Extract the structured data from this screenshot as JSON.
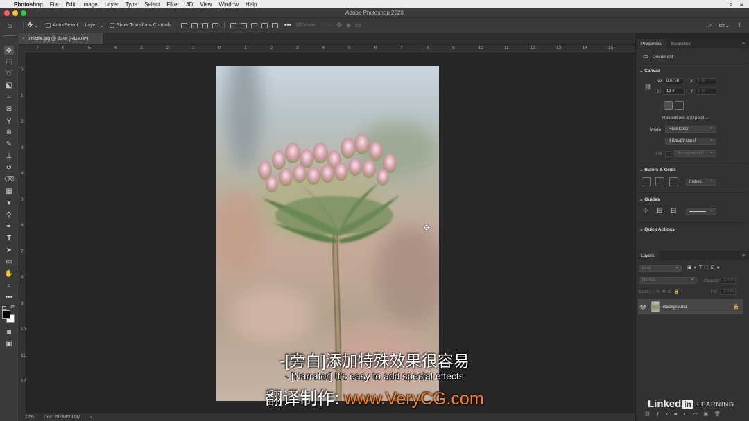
{
  "menubar": {
    "app": "Photoshop",
    "items": [
      "File",
      "Edit",
      "Image",
      "Layer",
      "Type",
      "Select",
      "Filter",
      "3D",
      "View",
      "Window",
      "Help"
    ]
  },
  "window": {
    "title": "Adobe Photoshop 2020"
  },
  "options": {
    "auto_select_label": "Auto-Select:",
    "auto_select_target": "Layer",
    "show_transform_label": "Show Transform Controls",
    "mode_3d_label": "3D Mode:"
  },
  "document": {
    "tab_title": "Thistle.jpg @ 22% (RGB/8*)"
  },
  "rulers": {
    "top_ticks": [
      "7",
      "6",
      "5",
      "4",
      "3",
      "2",
      "1",
      "0",
      "1",
      "2",
      "3",
      "4",
      "5",
      "6",
      "7",
      "8",
      "9",
      "10",
      "11",
      "12",
      "13",
      "14",
      "15"
    ],
    "left_ticks": [
      "0",
      "1",
      "2",
      "3",
      "4",
      "5",
      "6",
      "7",
      "8",
      "9",
      "10",
      "11",
      "12"
    ]
  },
  "status": {
    "zoom": "22%",
    "doc": "Doc: 29.0M/29.0M"
  },
  "properties": {
    "tabs": [
      "Properties",
      "Swatches"
    ],
    "doc_label": "Document",
    "canvas_header": "Canvas",
    "w_label": "W",
    "w_value": "8.67 in",
    "h_label": "H",
    "h_value": "13 in",
    "x_label": "X",
    "x_value": "0 in",
    "y_label": "Y",
    "y_value": "0 in",
    "resolution": "Resolution: 300 pixel...",
    "mode_label": "Mode",
    "mode_value": "RGB Color",
    "bits_value": "8 Bits/Channel",
    "fill_label": "Fill",
    "fill_value": "Background C...",
    "rulers_header": "Rulers & Grids",
    "units_value": "Inches",
    "guides_header": "Guides",
    "quick_actions_header": "Quick Actions"
  },
  "layers": {
    "tab": "Layers",
    "kind_placeholder": "Kind",
    "blend_mode": "Normal",
    "opacity_label": "Opacity:",
    "opacity_value": "100%",
    "lock_label": "Lock:",
    "fill_label": "Fill:",
    "fill_value": "100%",
    "items": [
      {
        "name": "Background"
      }
    ]
  },
  "subtitles": {
    "zh": "-[旁白]添加特殊效果很容易",
    "en": "- [Narrator] It's easy to add special effects",
    "credit_prefix": "翻译制作: ",
    "credit_url": "www.VeryCG.com"
  },
  "watermark": {
    "brand": "Linked",
    "in": "in",
    "suffix": "LEARNING"
  },
  "colors": {
    "accent": "#ff7f27",
    "app_bg": "#262626",
    "panel_bg": "#323232"
  }
}
